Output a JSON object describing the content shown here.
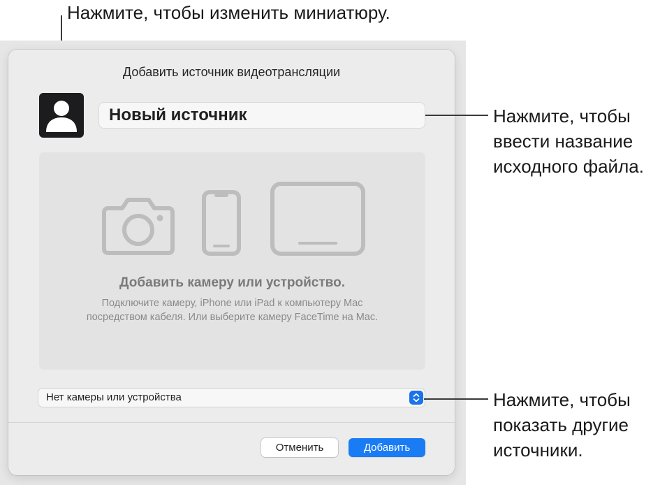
{
  "callouts": {
    "thumbnail": "Нажмите, чтобы изменить миниатюру.",
    "name": [
      "Нажмите, чтобы",
      "ввести название",
      "исходного файла."
    ],
    "sources": [
      "Нажмите, чтобы",
      "показать другие",
      "источники."
    ]
  },
  "dialog": {
    "title": "Добавить источник видеотрансляции",
    "thumbnail_icon": "person-icon",
    "name_value": "Новый источник",
    "preview": {
      "icons": [
        "camera-icon",
        "iphone-icon",
        "ipad-icon"
      ],
      "heading": "Добавить камеру или устройство.",
      "description": [
        "Подключите камеру, iPhone или iPad к компьютеру Mac",
        "посредством кабеля. Или выберите камеру FaceTime на Mac."
      ]
    },
    "source_select": {
      "value": "Нет камеры или устройства",
      "stepper_icon": "chevron-up-down-icon"
    },
    "buttons": {
      "cancel": "Отменить",
      "add": "Добавить"
    },
    "colors": {
      "accent": "#1a7cf5",
      "thumbnail_bg": "#1c1c1e",
      "dialog_bg": "#ececec",
      "preview_bg": "#e3e3e3",
      "icon_gray": "#bdbdbd"
    }
  }
}
